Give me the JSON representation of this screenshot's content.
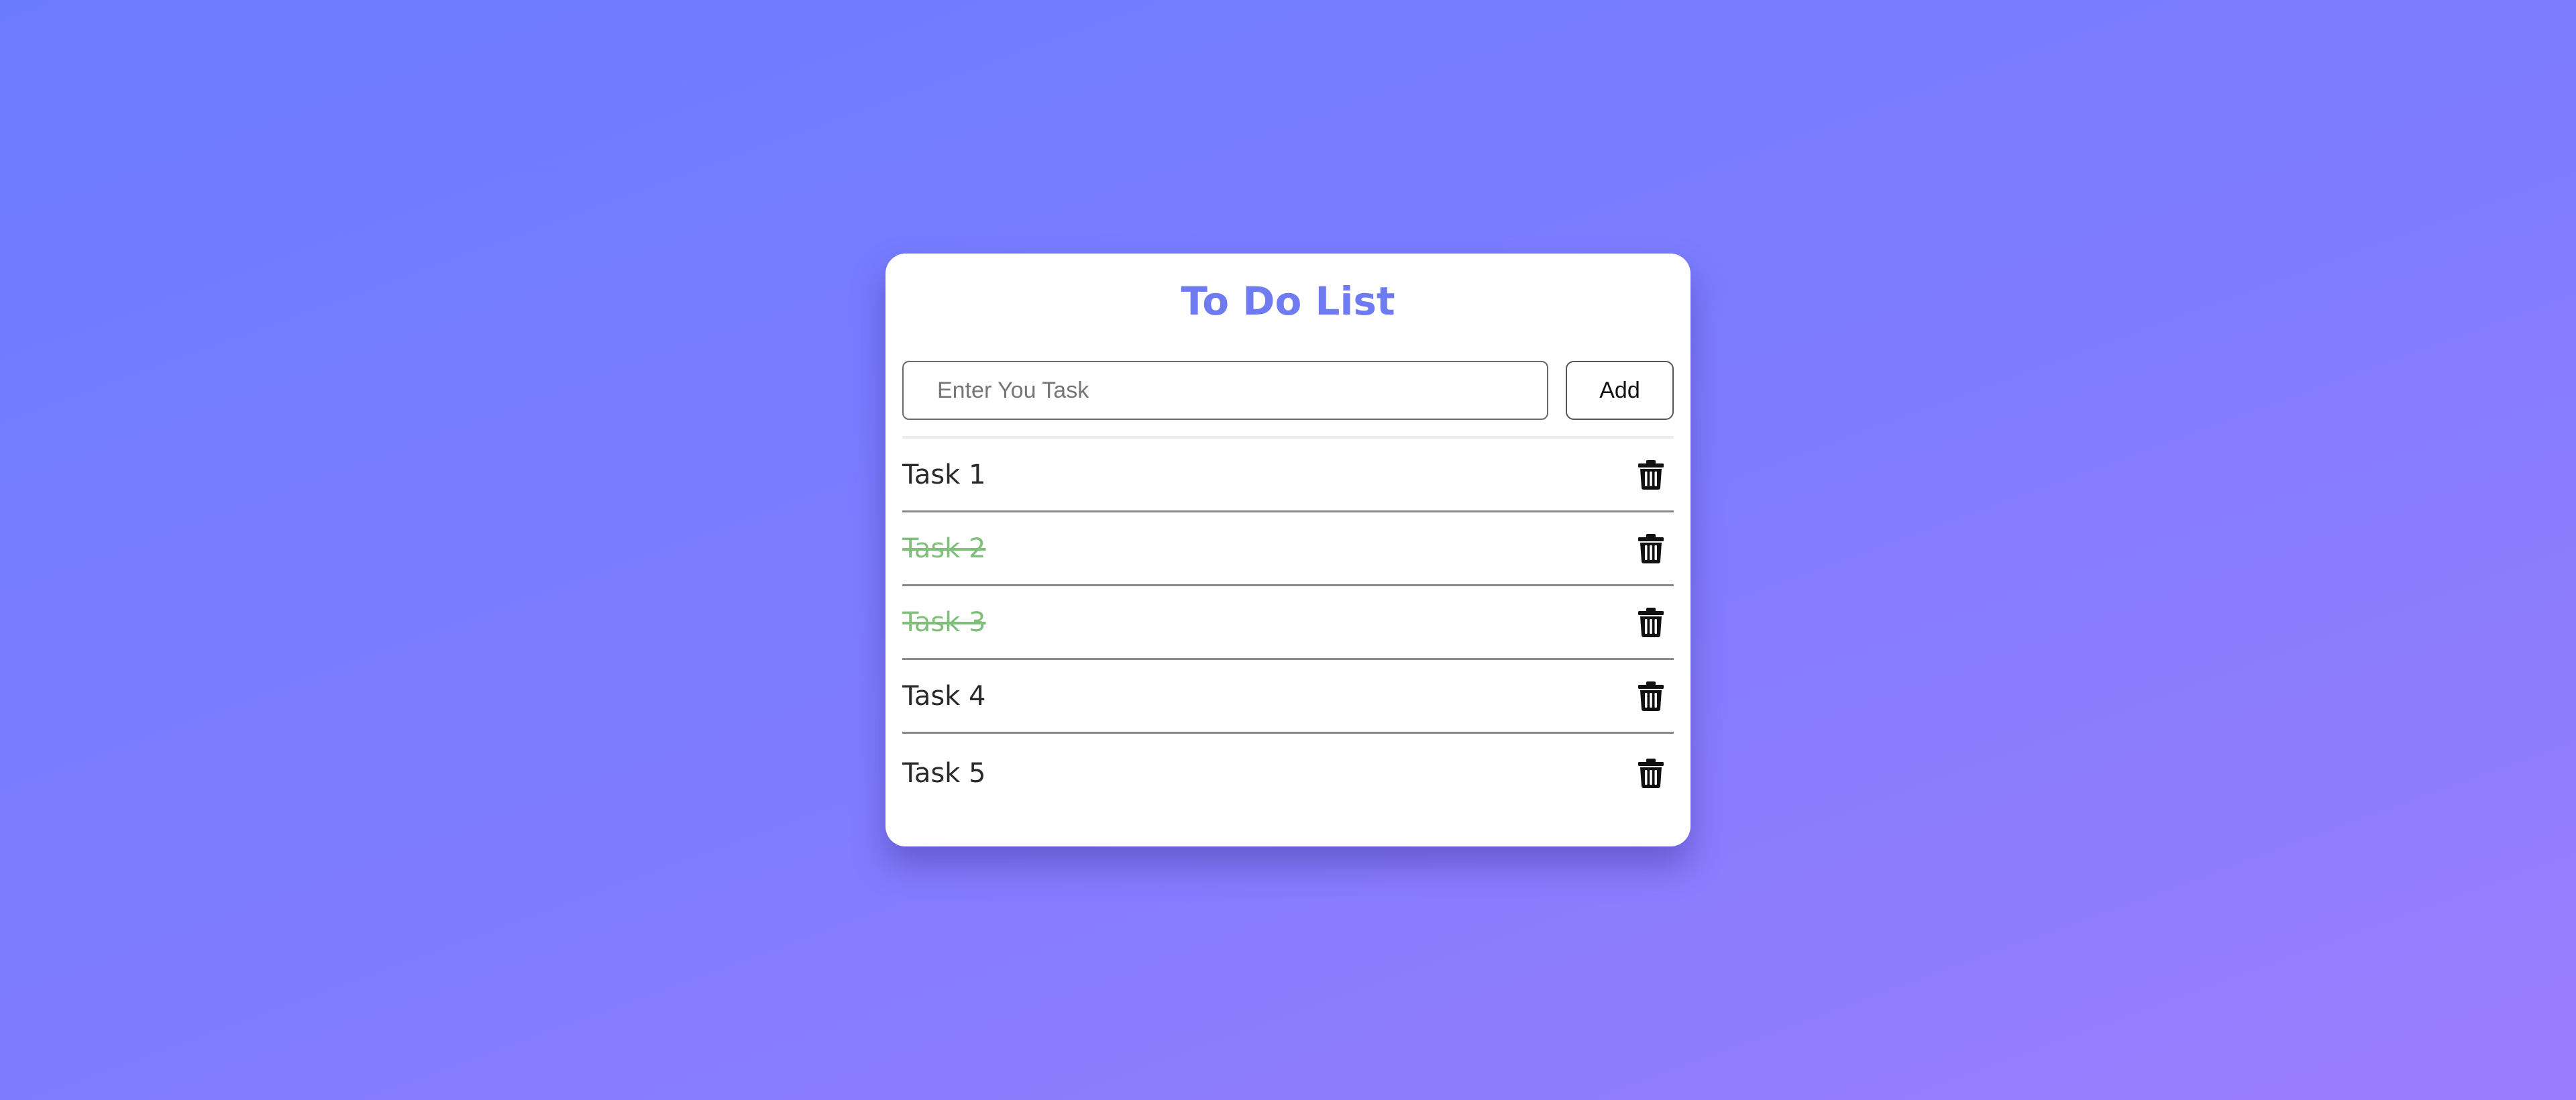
{
  "app": {
    "title": "To Do List"
  },
  "input": {
    "value": "",
    "placeholder": "Enter You Task"
  },
  "add_button": {
    "label": "Add"
  },
  "tasks": [
    {
      "text": "Task 1",
      "completed": false
    },
    {
      "text": "Task 2",
      "completed": true
    },
    {
      "text": "Task 3",
      "completed": true
    },
    {
      "text": "Task 4",
      "completed": false
    },
    {
      "text": "Task 5",
      "completed": false
    }
  ],
  "icons": {
    "delete": "trash-icon"
  },
  "colors": {
    "title": "#6f7bf0",
    "completed_task": "#7fbf7a",
    "background_start": "#6b7bff",
    "background_end": "#9a7dfe"
  }
}
